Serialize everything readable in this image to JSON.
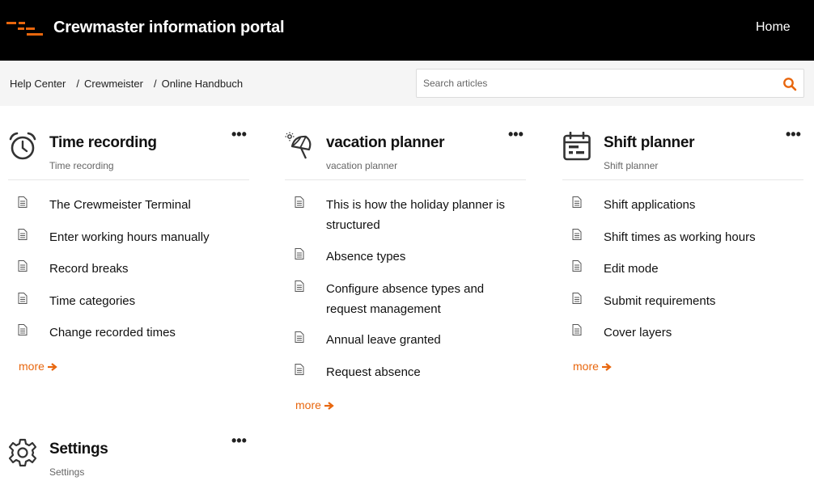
{
  "header": {
    "brand": "Crewmaster information portal",
    "nav_home": "Home",
    "colors": {
      "background": "#000000",
      "accent": "#e8660d"
    }
  },
  "breadcrumb": {
    "items": [
      "Help Center",
      "Crewmeister",
      "Online Handbuch"
    ],
    "separator": "/"
  },
  "search": {
    "placeholder": "Search articles",
    "value": ""
  },
  "menu_glyph": "•••",
  "sections": [
    {
      "icon": "alarm-clock-icon",
      "title": "Time recording",
      "subtitle": "Time recording",
      "articles": [
        "The Crewmeister Terminal",
        "Enter working hours manually",
        "Record breaks",
        "Time categories",
        "Change recorded times"
      ],
      "more": "more"
    },
    {
      "icon": "beach-umbrella-icon",
      "title": "vacation planner",
      "subtitle": "vacation planner",
      "articles": [
        "This is how the holiday planner is structured",
        "Absence types",
        "Configure absence types and request management",
        "Annual leave granted",
        "Request absence"
      ],
      "more": "more"
    },
    {
      "icon": "calendar-icon",
      "title": "Shift planner",
      "subtitle": "Shift planner",
      "articles": [
        "Shift applications",
        "Shift times as working hours",
        "Edit mode",
        "Submit requirements",
        "Cover layers"
      ],
      "more": "more"
    },
    {
      "icon": "gear-icon",
      "title": "Settings",
      "subtitle": "Settings",
      "articles": [],
      "more": ""
    }
  ]
}
